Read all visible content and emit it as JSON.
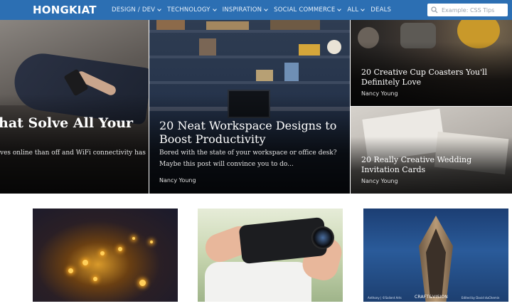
{
  "header": {
    "logo": "HONGKIAT",
    "nav": [
      {
        "label": "DESIGN / DEV",
        "dropdown": true
      },
      {
        "label": "TECHNOLOGY",
        "dropdown": true
      },
      {
        "label": "INSPIRATION",
        "dropdown": true
      },
      {
        "label": "SOCIAL COMMERCE",
        "dropdown": true
      },
      {
        "label": "ALL",
        "dropdown": true
      },
      {
        "label": "DEALS",
        "dropdown": false
      }
    ],
    "search_placeholder": "Example: CSS Tips"
  },
  "hero": {
    "left": {
      "title": "hat Solve All Your",
      "excerpt": "ves online than off and WiFi connectivity has"
    },
    "center": {
      "title_line1": "20 Neat Workspace Designs to",
      "title_line2": "Boost Productivity",
      "excerpt_line1": "Bored with the state of your workspace or office desk?",
      "excerpt_line2": "Maybe this post will convince you to do...",
      "author": "Nancy Young"
    },
    "right_top": {
      "title_line1": "20 Creative Cup Coasters You'll",
      "title_line2": "Definitely Love",
      "author": "Nancy Young"
    },
    "right_bottom": {
      "title_line1": "20 Really Creative Wedding",
      "title_line2": "Invitation Cards",
      "author": "Nancy Young"
    }
  },
  "thumbnails": {
    "third_caption_left": "Anthony | ©Salient Arts",
    "third_caption_brand": "CRAFT&VISION",
    "third_caption_right": "Edited by David duChemin"
  },
  "colors": {
    "nav_bg": "#2c6fb3",
    "text_light": "#ffffff"
  }
}
